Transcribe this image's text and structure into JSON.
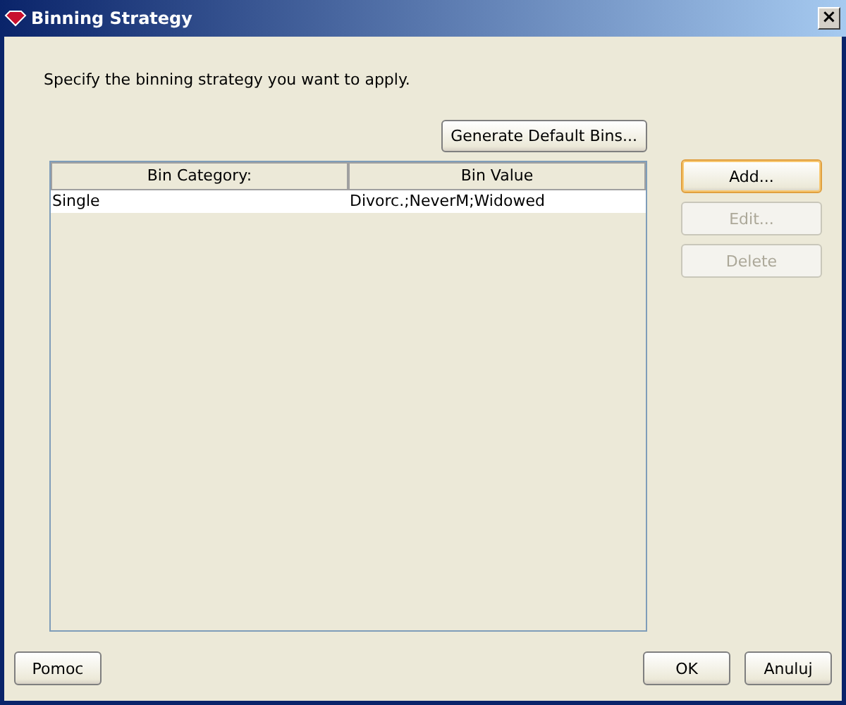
{
  "window": {
    "title": "Binning Strategy",
    "close": "×"
  },
  "instruction": "Specify the binning strategy you want to apply.",
  "generate_button": {
    "label": "Generate Default Bins...",
    "disabled": false
  },
  "table": {
    "columns": [
      "Bin Category:",
      "Bin Value"
    ],
    "rows": [
      {
        "cells": [
          "Single",
          "Divorc.;NeverM;Widowed"
        ],
        "selected": false
      }
    ]
  },
  "side_buttons": [
    {
      "label": "Add...",
      "disabled": false,
      "focused": true
    },
    {
      "label": "Edit...",
      "disabled": true,
      "focused": false
    },
    {
      "label": "Delete",
      "disabled": true,
      "focused": false
    }
  ],
  "footer": {
    "help": {
      "label": "Pomoc",
      "disabled": false
    },
    "ok": {
      "label": "OK",
      "disabled": false
    },
    "cancel": {
      "label": "Anuluj",
      "disabled": false
    }
  }
}
